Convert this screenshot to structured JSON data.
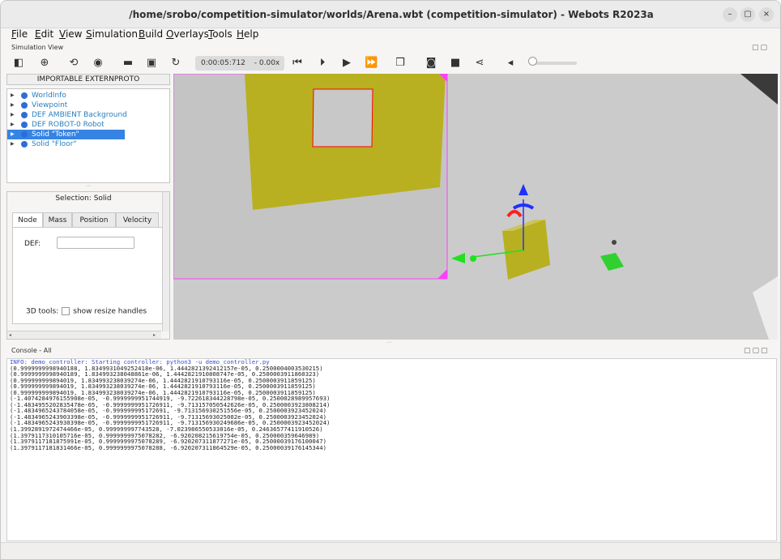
{
  "window": {
    "title": "/home/srobo/competition-simulator/worlds/Arena.wbt (competition-simulator) - Webots R2023a",
    "controls": [
      "–",
      "▢",
      "×"
    ]
  },
  "menu": [
    {
      "label": "File",
      "accel": "F",
      "rest": "ile"
    },
    {
      "label": "Edit",
      "accel": "E",
      "rest": "dit"
    },
    {
      "label": "View",
      "accel": "V",
      "rest": "iew"
    },
    {
      "label": "Simulation",
      "accel": "S",
      "rest": "imulation"
    },
    {
      "label": "Build",
      "accel": "B",
      "rest": "uild"
    },
    {
      "label": "Overlays",
      "accel": "O",
      "rest": "verlays"
    },
    {
      "label": "Tools",
      "accel": "T",
      "rest": "ools"
    },
    {
      "label": "Help",
      "accel": "H",
      "rest": "elp"
    }
  ],
  "simulation_view": {
    "label": "Simulation View",
    "dock_buttons": "▢▢"
  },
  "toolbar": {
    "time": "0:00:05:712",
    "speed": "- 0.00x",
    "icons": [
      "panel-toggle-icon",
      "add-icon",
      "reload-icon",
      "eye-icon",
      "open-folder-icon",
      "save-icon",
      "revert-icon",
      "step-back-icon",
      "step-icon",
      "play-icon",
      "fast-forward-icon",
      "render-icon",
      "camera-icon",
      "record-icon",
      "share-icon",
      "volume-icon"
    ],
    "volume": 0.0
  },
  "scene_tree": {
    "import_button": "IMPORTABLE EXTERNPROTO",
    "items": [
      {
        "label": "WorldInfo",
        "selected": false
      },
      {
        "label": "Viewpoint",
        "selected": false
      },
      {
        "label": "DEF AMBIENT Background",
        "selected": false
      },
      {
        "label": "DEF ROBOT-0 Robot",
        "selected": false
      },
      {
        "label": "Solid \"Token\"",
        "selected": true
      },
      {
        "label": "Solid \"Floor\"",
        "selected": false
      }
    ]
  },
  "node_panel": {
    "selection": "Selection: Solid",
    "tabs": [
      "Node",
      "Mass",
      "Position",
      "Velocity"
    ],
    "active_tab": "Node",
    "def_label": "DEF:",
    "def_value": "",
    "tools_label": "3D tools:",
    "resize_handles_label": "show resize handles",
    "resize_handles_checked": false
  },
  "console": {
    "label": "Console - All",
    "dock_buttons": "▢▢▢",
    "lines": [
      "INFO: demo_controller: Starting controller: python3 -u demo_controller.py",
      "(0.9999999998940188, 1.8349931049252418e-06, 1.4442821392412157e-05, 0.2500004003530215)",
      "(0.9999999998940189, 1.834993238048861e-06, 1.4442821910808747e-05, 0.2500003911860323)",
      "(0.999999999894019, 1.834993238039274e-06, 1.4442821910793116e-05, 0.2500003911859125)",
      "(0.999999999894019, 1.834993238039274e-06, 1.4442821910793116e-05, 0.2500003911859125)",
      "(0.999999999894019, 1.834993238039274e-06, 1.4442821910793116e-05, 0.2500003911859125)",
      "(-1.4074284976155908e-05, -0.9999999951744919, -9.722618344228798e-05, 0.2500028989957693)",
      "(-1.4834955202835478e-05, -0.9999999951726911, -9.713157050542626e-05, 0.2500003923808214)",
      "(-1.4834965243784058e-05, -0.999999995172691, -9.713156930251556e-05, 0.2500003923452024)",
      "(-1.4834965243903398e-05, -0.9999999951726911, -9.71315693025002e-05, 0.2500003923452024)",
      "(-1.4834965243930398e-05, -0.9999999951726911, -9.713156930249686e-05, 0.2500003923452024)",
      "(1.3992891972474466e-05, 0.999999997743528, -7.023986550533016e-05, 0.24636577411910526)",
      "(1.3979117310105716e-05, 0.9999999975078282, -6.920208215619754e-05, 0.250000359646989)",
      "(1.3979117181875991e-05, 0.9999999975078289, -6.920207311877271e-05, 0.25000039176100047)",
      "(1.3979117181831466e-05, 0.9999999975078288, -6.920207311864529e-05, 0.25000039176145344)"
    ]
  },
  "colors": {
    "selection": "#3584e4",
    "tree_text": "#2a7ebf",
    "info_text": "#3c4bd6",
    "wall": "#b8b020",
    "floor": "#c8c8c8",
    "camera_border": "#ff40ff",
    "token_highlight": "#ff0000"
  }
}
